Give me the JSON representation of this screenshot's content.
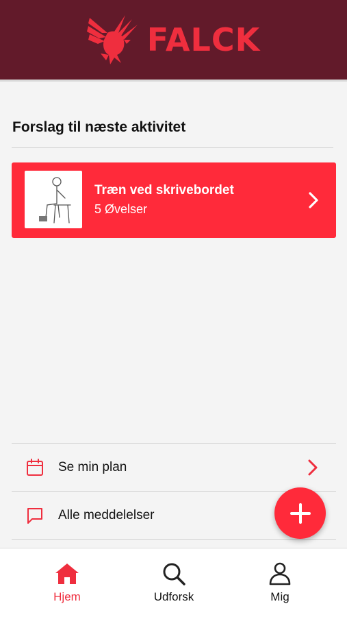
{
  "header": {
    "brand": "FALCK"
  },
  "suggestions": {
    "title": "Forslag til næste aktivitet",
    "card": {
      "title": "Træn ved skrivebordet",
      "subtitle": "5 Øvelser"
    }
  },
  "list": [
    {
      "label": "Se min plan",
      "icon": "calendar-icon"
    },
    {
      "label": "Alle meddelelser",
      "icon": "message-icon"
    }
  ],
  "fab": {
    "icon": "plus-icon"
  },
  "nav": [
    {
      "label": "Hjem",
      "icon": "home-icon",
      "active": true
    },
    {
      "label": "Udforsk",
      "icon": "search-icon",
      "active": false
    },
    {
      "label": "Mig",
      "icon": "person-icon",
      "active": false
    }
  ],
  "colors": {
    "header": "#621a2a",
    "accent": "#ff2a3a",
    "brand": "#ef2e3e"
  }
}
